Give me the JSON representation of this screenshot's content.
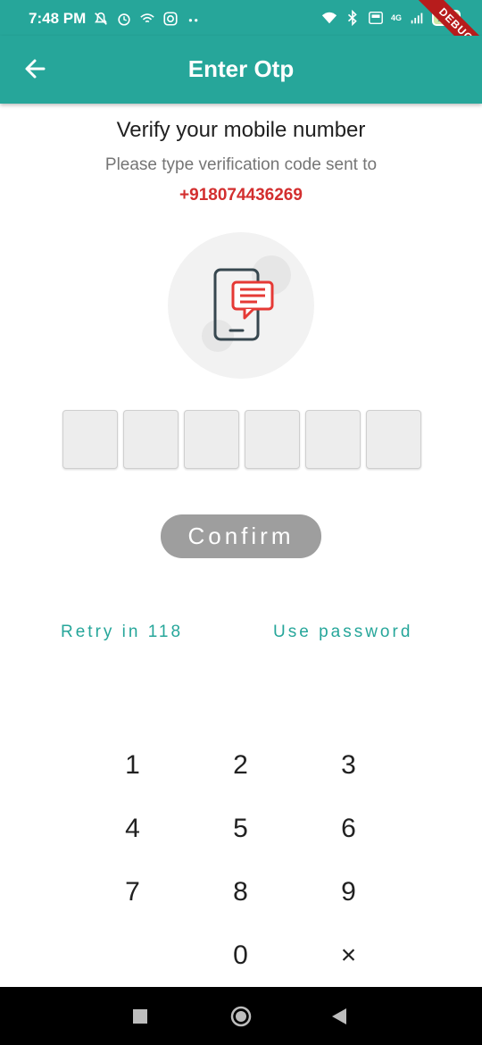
{
  "status_bar": {
    "time": "7:48 PM",
    "left_icons": [
      "mute-icon",
      "alarm-icon",
      "wifi-calling-icon",
      "instagram-icon",
      "more-dots-icon"
    ],
    "right_icons": [
      "wifi-icon",
      "bluetooth-icon",
      "volte-icon",
      "signal-4g-icon"
    ],
    "network_label": "4G",
    "battery": "100"
  },
  "debug_banner": "DEBUG",
  "app_bar": {
    "title": "Enter Otp",
    "back_icon": "arrow-left-icon"
  },
  "verify": {
    "heading": "Verify your mobile number",
    "subtitle": "Please type verification code sent to",
    "phone": "+918074436269"
  },
  "illustration": {
    "icon": "phone-message-icon",
    "accent_color": "#e53935"
  },
  "otp": {
    "digits": [
      "",
      "",
      "",
      "",
      "",
      ""
    ]
  },
  "confirm_button": "Confirm",
  "links": {
    "retry": "Retry in 118",
    "use_password": "Use password"
  },
  "keypad": {
    "keys": [
      "1",
      "2",
      "3",
      "4",
      "5",
      "6",
      "7",
      "8",
      "9",
      "",
      "0",
      "×"
    ]
  },
  "nav_bar": {
    "buttons": [
      "recents-square-icon",
      "home-circle-icon",
      "back-triangle-icon"
    ]
  },
  "colors": {
    "primary": "#26a69a",
    "accent": "#d32f2f",
    "button_disabled": "#9e9e9e"
  }
}
